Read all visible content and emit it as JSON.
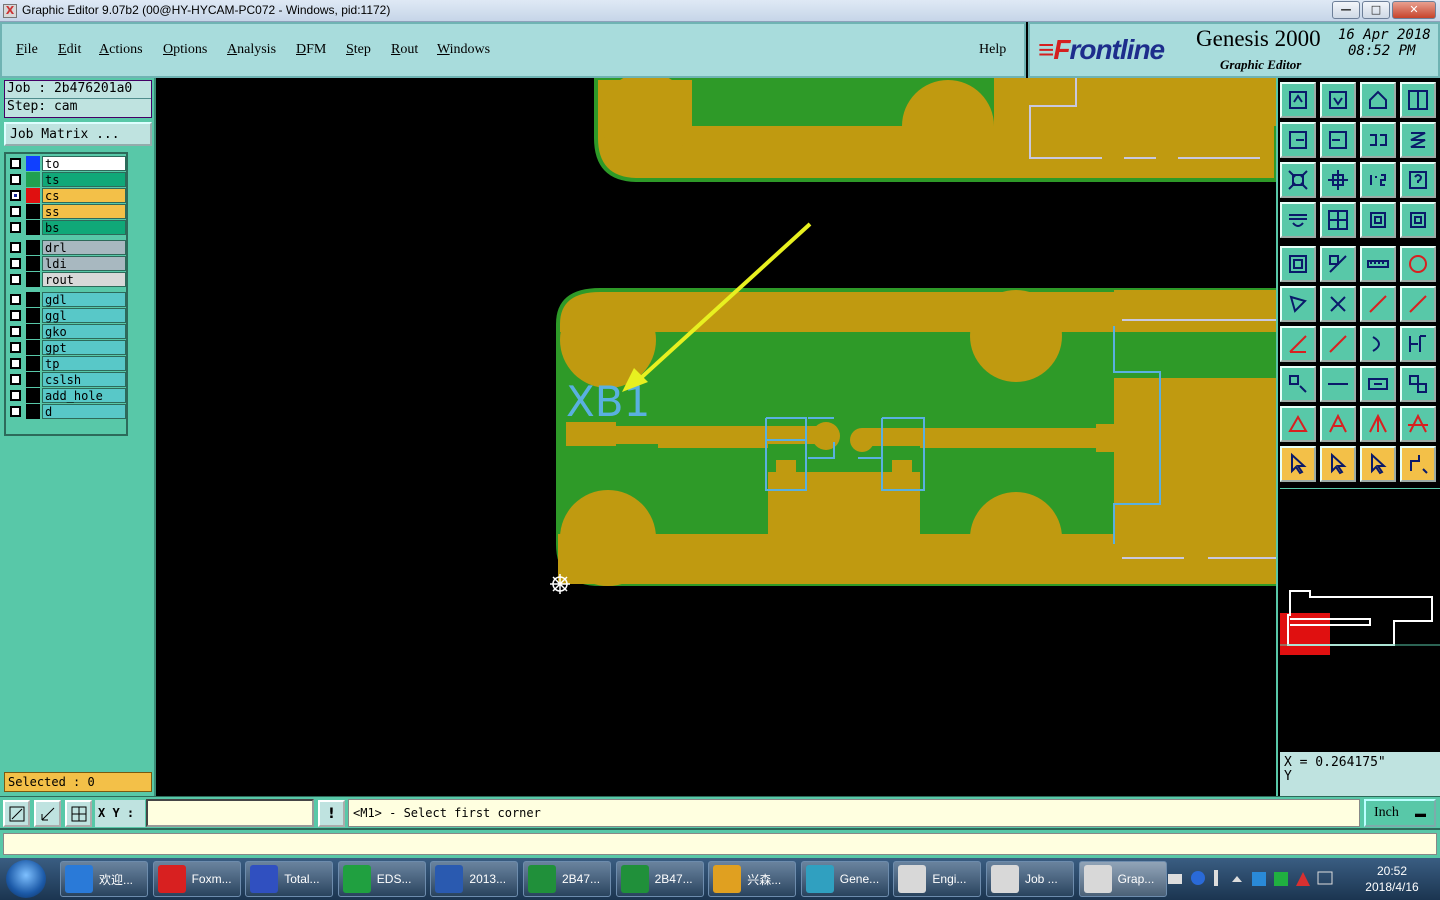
{
  "window": {
    "title": "Graphic Editor 9.07b2 (00@HY-HYCAM-PC072 - Windows, pid:1172)",
    "app_icon": "X",
    "controls": [
      "minimize-icon",
      "maximize-icon",
      "close-icon"
    ],
    "minimize_label": "—",
    "maximize_label": "□",
    "close_label": "✕"
  },
  "menu": {
    "items": [
      {
        "label": "File",
        "underline": "F"
      },
      {
        "label": "Edit",
        "underline": "E"
      },
      {
        "label": "Actions",
        "underline": "A"
      },
      {
        "label": "Options",
        "underline": "O"
      },
      {
        "label": "Analysis",
        "underline": "A"
      },
      {
        "label": "DFM",
        "underline": "D"
      },
      {
        "label": "Step",
        "underline": "S"
      },
      {
        "label": "Rout",
        "underline": "R"
      },
      {
        "label": "Windows",
        "underline": "W"
      }
    ],
    "help": "Help"
  },
  "brand": {
    "logo_mark": "≡F",
    "logo_text": "rontline",
    "product": "Genesis 2000",
    "subtitle": "Graphic Editor",
    "date": "16 Apr 2018",
    "time": "08:52 PM"
  },
  "job": {
    "job_line": "Job : 2b476201a0",
    "step_line": "Step: cam",
    "matrix_button": "Job Matrix ..."
  },
  "layers": [
    {
      "name": "to",
      "color": "#1040ff",
      "bg": "#ffffff",
      "checked": false
    },
    {
      "name": "ts",
      "color": "#20a050",
      "bg": "#10a878",
      "checked": false
    },
    {
      "name": "cs",
      "color": "#e01010",
      "bg": "#f3c048",
      "checked": true
    },
    {
      "name": "ss",
      "color": "#ffffff",
      "bg": "#f3c048",
      "checked": false
    },
    {
      "name": "bs",
      "color": "#ffffff",
      "bg": "#10a878",
      "checked": false
    },
    {
      "name": "drl",
      "color": "#ffffff",
      "bg": "#a8b8c0",
      "checked": false
    },
    {
      "name": "ldi",
      "color": "#ffffff",
      "bg": "#a8b8c0",
      "checked": false
    },
    {
      "name": "rout",
      "color": "#ffffff",
      "bg": "#d8d8d8",
      "checked": false
    },
    {
      "name": "gdl",
      "color": "#ffffff",
      "bg": "#58c8c8",
      "checked": false
    },
    {
      "name": "ggl",
      "color": "#ffffff",
      "bg": "#58c8c8",
      "checked": false
    },
    {
      "name": "gko",
      "color": "#ffffff",
      "bg": "#58c8c8",
      "checked": false
    },
    {
      "name": "gpt",
      "color": "#ffffff",
      "bg": "#58c8c8",
      "checked": false
    },
    {
      "name": "tp",
      "color": "#ffffff",
      "bg": "#58c8c8",
      "checked": false
    },
    {
      "name": "cslsh",
      "color": "#ffffff",
      "bg": "#58c8c8",
      "checked": false
    },
    {
      "name": "add_hole",
      "color": "#ffffff",
      "bg": "#58c8c8",
      "checked": false
    },
    {
      "name": "d",
      "color": "#ffffff",
      "bg": "#58c8c8",
      "checked": false
    }
  ],
  "selected": "Selected : 0",
  "canvas": {
    "label_text": "XB1",
    "colors": {
      "copper": "#c09a10",
      "mask": "#2e9a28",
      "outline": "#5ab0e0",
      "arrow": "#e8f020",
      "profile": "#c8c8e0"
    }
  },
  "coords": {
    "x": "X = 0.264175\"",
    "y": "Y"
  },
  "command": {
    "xy_label": "X Y :",
    "xy_value": "",
    "bang": "!",
    "prompt": "<M1> - Select first corner",
    "unit": "Inch"
  },
  "taskbar": {
    "tasks": [
      {
        "label": "欢迎...",
        "color": "#2a7ad8"
      },
      {
        "label": "Foxm...",
        "color": "#d82020"
      },
      {
        "label": "Total...",
        "color": "#3050c0"
      },
      {
        "label": "EDS...",
        "color": "#20a040"
      },
      {
        "label": "2013...",
        "color": "#2a5ab0"
      },
      {
        "label": "2B47...",
        "color": "#20903a"
      },
      {
        "label": "2B47...",
        "color": "#20903a"
      },
      {
        "label": "兴森...",
        "color": "#e0a020"
      },
      {
        "label": "Gene...",
        "color": "#30a0c0"
      },
      {
        "label": "Engi...",
        "color": "#d8d8d8"
      },
      {
        "label": "Job ...",
        "color": "#d8d8d8"
      },
      {
        "label": "Grap...",
        "color": "#d8d8d8"
      }
    ],
    "clock_time": "20:52",
    "clock_date": "2018/4/16"
  }
}
